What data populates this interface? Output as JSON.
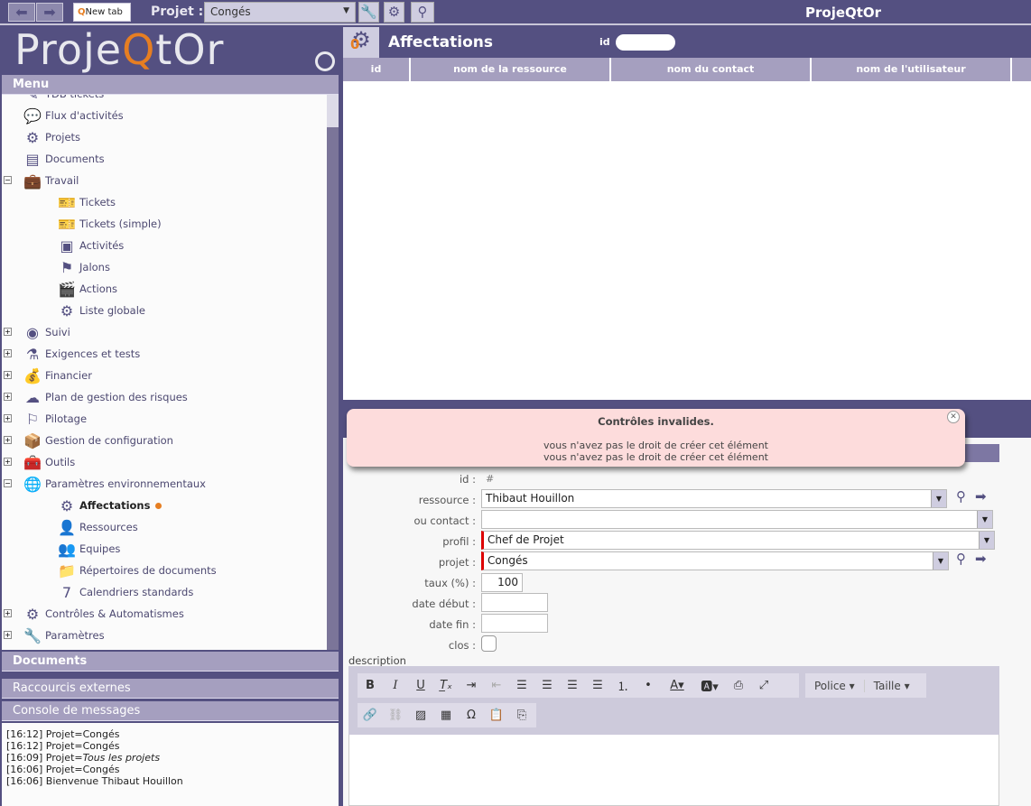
{
  "topbar": {
    "new_tab": "New tab",
    "project_label": "Projet :",
    "project_value": "Congés",
    "app_title": "ProjeQtOr"
  },
  "logo": {
    "text_a": "Proje",
    "text_q": "Q",
    "text_b": "tOr"
  },
  "left": {
    "menu": "Menu",
    "documents": "Documents",
    "shortcuts": "Raccourcis externes",
    "console": "Console de messages"
  },
  "tree": [
    {
      "label": "TDB tickets",
      "icon": "✎"
    },
    {
      "label": "Flux d'activités",
      "icon": "💬"
    },
    {
      "label": "Projets",
      "icon": "⚙"
    },
    {
      "label": "Documents",
      "icon": "▤"
    },
    {
      "label": "Travail",
      "icon": "💼",
      "toggle": "−"
    },
    {
      "label": "Tickets",
      "icon": "🎫"
    },
    {
      "label": "Tickets (simple)",
      "icon": "🎫"
    },
    {
      "label": "Activités",
      "icon": "▣"
    },
    {
      "label": "Jalons",
      "icon": "⚑"
    },
    {
      "label": "Actions",
      "icon": "🎬"
    },
    {
      "label": "Liste globale",
      "icon": "⚙"
    },
    {
      "label": "Suivi",
      "icon": "◉",
      "toggle": "+"
    },
    {
      "label": "Exigences et tests",
      "icon": "⚗",
      "toggle": "+"
    },
    {
      "label": "Financier",
      "icon": "💰",
      "toggle": "+"
    },
    {
      "label": "Plan de gestion des risques",
      "icon": "☁",
      "toggle": "+"
    },
    {
      "label": "Pilotage",
      "icon": "⚐",
      "toggle": "+"
    },
    {
      "label": "Gestion de configuration",
      "icon": "📦",
      "toggle": "+"
    },
    {
      "label": "Outils",
      "icon": "🧰",
      "toggle": "+"
    },
    {
      "label": "Paramètres environnementaux",
      "icon": "🌐",
      "toggle": "−"
    },
    {
      "label": "Affectations",
      "icon": "⚙"
    },
    {
      "label": "Ressources",
      "icon": "👤"
    },
    {
      "label": "Equipes",
      "icon": "👥"
    },
    {
      "label": "Répertoires de documents",
      "icon": "📁"
    },
    {
      "label": "Calendriers standards",
      "icon": "7"
    },
    {
      "label": "Contrôles & Automatismes",
      "icon": "⚙",
      "toggle": "+"
    },
    {
      "label": "Paramètres",
      "icon": "🔧",
      "toggle": "+"
    }
  ],
  "console_lines": [
    {
      "time": "[16:12]",
      "text": "Projet=Congés"
    },
    {
      "time": "[16:12]",
      "text": "Projet=Congés"
    },
    {
      "time": "[16:09]",
      "text": "Projet=",
      "italic": "Tous les projets"
    },
    {
      "time": "[16:06]",
      "text": "Projet=Congés"
    },
    {
      "time": "[16:06]",
      "text": "Bienvenue Thibaut Houillon"
    }
  ],
  "main": {
    "title": "Affectations",
    "id_label": "id",
    "badge": "0",
    "columns": [
      "id",
      "nom de la ressource",
      "nom du contact",
      "nom de l'utilisateur"
    ]
  },
  "toast": {
    "title": "Contrôles invalides.",
    "lines": [
      "vous n'avez pas le droit de créer cet élément",
      "vous n'avez pas le droit de créer cet élément"
    ]
  },
  "form": {
    "id_label": "id :",
    "id_value": "#",
    "resource_label": "ressource :",
    "resource_value": "Thibaut Houillon",
    "contact_label": "ou contact :",
    "contact_value": "",
    "profile_label": "profil :",
    "profile_value": "Chef de Projet",
    "project_label": "projet :",
    "project_value": "Congés",
    "rate_label": "taux (%) :",
    "rate_value": "100",
    "start_label": "date début :",
    "start_value": "",
    "end_label": "date fin :",
    "end_value": "",
    "closed_label": "clos :",
    "closed": false,
    "description_label": "description"
  },
  "editor": {
    "font": "Police",
    "size": "Taille"
  }
}
